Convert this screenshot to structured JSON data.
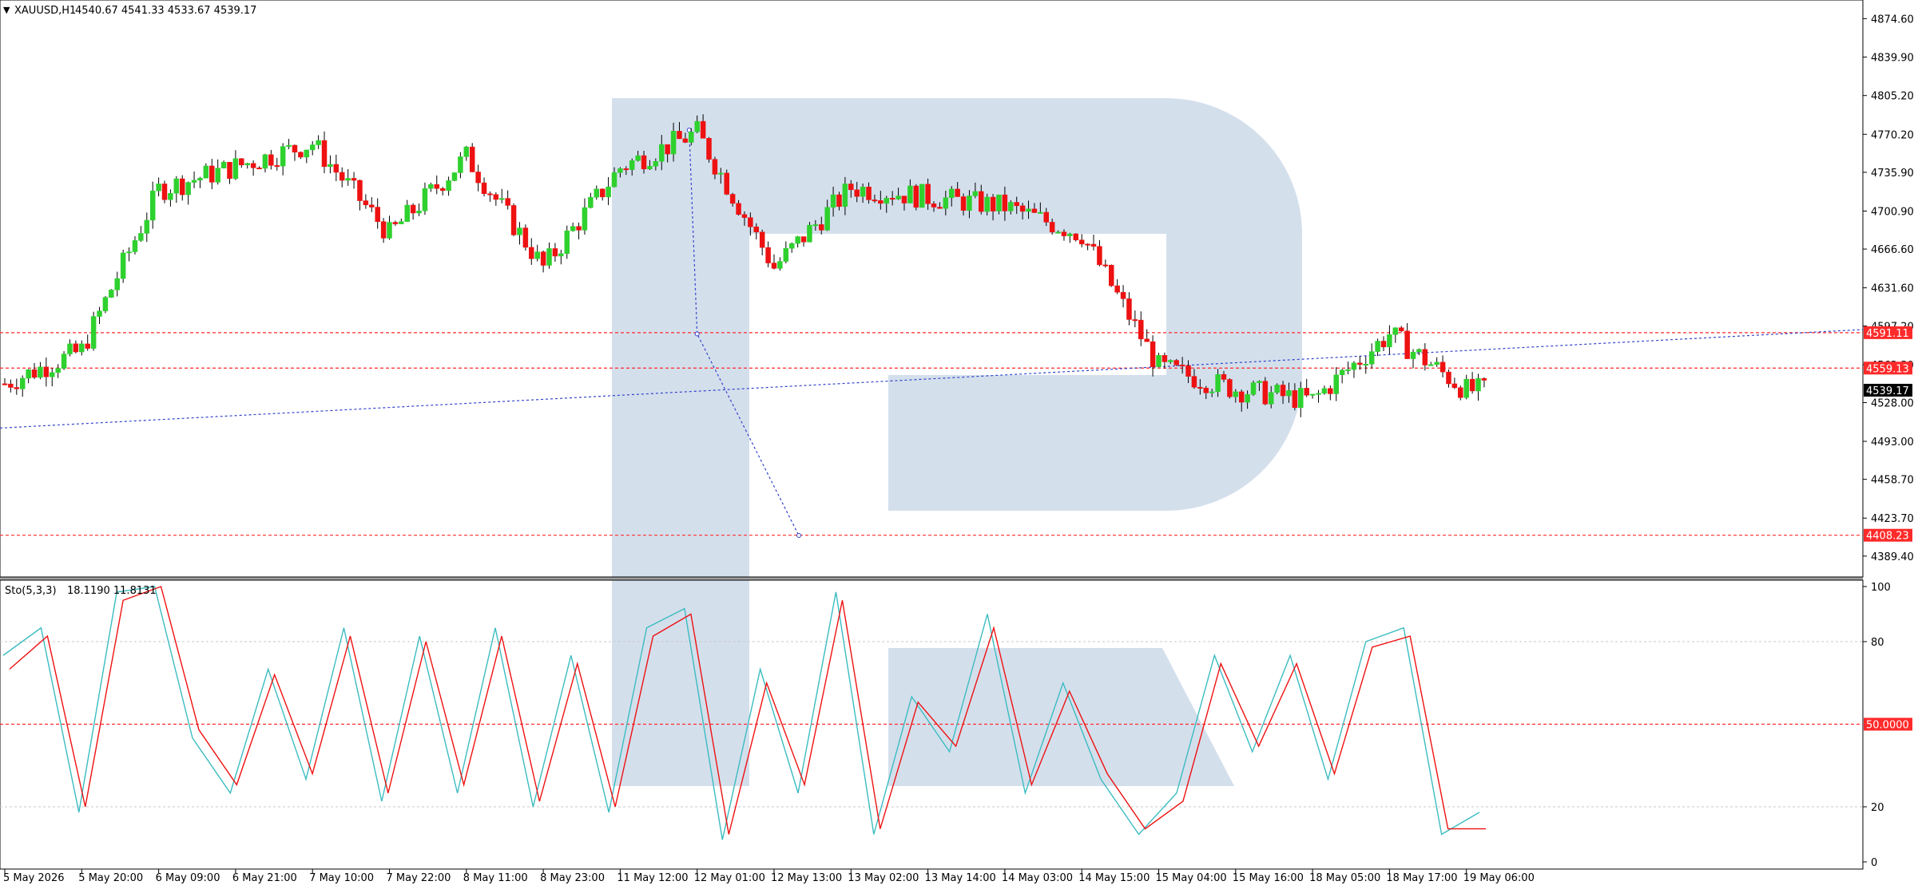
{
  "header": {
    "symbol": "XAUUSD,H1",
    "ohlc": "4540.67 4541.33 4533.67 4539.17"
  },
  "indicator": {
    "label": "Sto(5,3,3)",
    "values": "18.1190 11.8131"
  },
  "colors": {
    "bull": "#2ed12e",
    "bear": "#ee1111",
    "level_line": "#ff2a2a",
    "trend_line": "#3344cc",
    "stoch_main": "#3bbcc0",
    "stoch_signal": "#ee1111",
    "watermark": "#d4dfec"
  },
  "chart_data": [
    {
      "type": "candlestick",
      "title": "",
      "series_name": "XAUUSD,H1",
      "ylim": [
        4372,
        4890
      ],
      "price_ticks": [
        "4874.60",
        "4839.90",
        "4805.20",
        "4770.20",
        "4735.90",
        "4700.90",
        "4666.60",
        "4631.60",
        "4597.20",
        "4562.30",
        "4528.00",
        "4493.00",
        "4458.70",
        "4423.70",
        "4389.40"
      ],
      "time_labels": [
        "5 May 2026",
        "5 May 20:00",
        "6 May 09:00",
        "6 May 21:00",
        "7 May 10:00",
        "7 May 22:00",
        "8 May 11:00",
        "8 May 23:00",
        "11 May 12:00",
        "12 May 01:00",
        "12 May 13:00",
        "13 May 02:00",
        "13 May 14:00",
        "14 May 03:00",
        "14 May 15:00",
        "15 May 04:00",
        "15 May 16:00",
        "18 May 05:00",
        "18 May 17:00",
        "19 May 06:00"
      ],
      "current_price": "4539.17",
      "levels": [
        {
          "label": "4591.11",
          "value": 4591.11
        },
        {
          "label": "4559.13",
          "value": 4559.13
        },
        {
          "label": "4408.23",
          "value": 4408.23
        }
      ],
      "key_points": [
        {
          "time": "5 May 2026",
          "price": 4545
        },
        {
          "time": "5 May 20:00",
          "price": 4575
        },
        {
          "time": "6 May 09:00",
          "price": 4720
        },
        {
          "time": "7 May 10:00",
          "price": 4762
        },
        {
          "time": "7 May 22:00",
          "price": 4680
        },
        {
          "time": "8 May 11:00",
          "price": 4750
        },
        {
          "time": "8 May 23:00",
          "price": 4650
        },
        {
          "time": "11 May 12:00",
          "price": 4740
        },
        {
          "time": "12 May 01:00",
          "price": 4772
        },
        {
          "time": "12 May 13:00",
          "price": 4650
        },
        {
          "time": "13 May 02:00",
          "price": 4722
        },
        {
          "time": "14 May 03:00",
          "price": 4705
        },
        {
          "time": "14 May 15:00",
          "price": 4680
        },
        {
          "time": "15 May 04:00",
          "price": 4560
        },
        {
          "time": "15 May 16:00",
          "price": 4540
        },
        {
          "time": "18 May 05:00",
          "price": 4530
        },
        {
          "time": "18 May 17:00",
          "price": 4590
        },
        {
          "time": "19 May 06:00",
          "price": 4539
        }
      ],
      "wave_marks": [
        {
          "time": "12 May 01:00",
          "price": 4774
        },
        {
          "time": "12 May 01:00",
          "price": 4590
        },
        {
          "time": "12 May 13:00",
          "price": 4408
        }
      ],
      "trend_line": [
        {
          "time": "5 May 2026",
          "price": 4505
        },
        {
          "time": "19 May 06:00",
          "price": 4575
        }
      ]
    },
    {
      "type": "line",
      "title": "Sto(5,3,3)",
      "ylim": [
        0,
        100
      ],
      "y_ticks": [
        "100",
        "80",
        "20",
        "0"
      ],
      "levels": [
        {
          "label": "50.0000",
          "value": 50
        }
      ],
      "series": [
        {
          "name": "main",
          "key_values": [
            75,
            85,
            18,
            98,
            100,
            45,
            25,
            70,
            30,
            85,
            22,
            82,
            25,
            85,
            20,
            75,
            18,
            85,
            92,
            8,
            70,
            25,
            98,
            10,
            60,
            40,
            90,
            25,
            65,
            30,
            10,
            25,
            75,
            40,
            75,
            30,
            80,
            85,
            10,
            18
          ]
        },
        {
          "name": "signal",
          "key_values": [
            70,
            82,
            20,
            95,
            100,
            48,
            28,
            68,
            32,
            82,
            25,
            80,
            28,
            82,
            22,
            72,
            20,
            82,
            90,
            10,
            65,
            28,
            95,
            12,
            58,
            42,
            85,
            28,
            62,
            32,
            12,
            22,
            72,
            42,
            72,
            32,
            78,
            82,
            12,
            12
          ]
        }
      ]
    }
  ]
}
